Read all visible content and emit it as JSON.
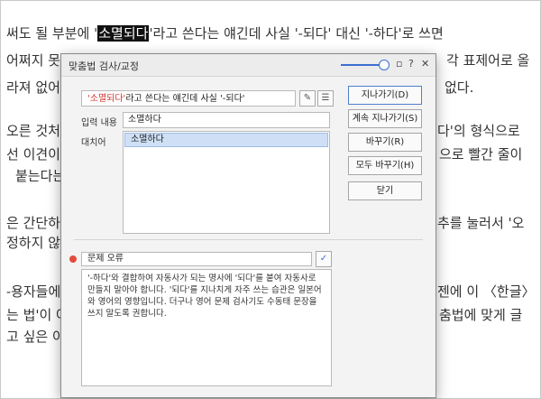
{
  "document": {
    "lines": [
      {
        "before": "써도 될 부분에 '",
        "highlight": "소멸되다",
        "after": "'라고 쓴다는 얘긴데 사실 '-되다' 대신 '-하다'로 쓰면"
      },
      {
        "text": "어쩌지 못"
      },
      {
        "text": "각 표제어로 올"
      },
      {
        "text": "라져 없어"
      },
      {
        "text": "없다."
      },
      {
        "text": "오른 것처럼"
      },
      {
        "text": "다'의 형식으로"
      },
      {
        "text": "선 이견이"
      },
      {
        "text": "으로 빨간 줄이"
      },
      {
        "text": "붙는다는"
      },
      {
        "text": "은 간단하"
      },
      {
        "text": "추를 눌러서 '오"
      },
      {
        "text": "정하지 않고"
      },
      {
        "text": "-용자들에게"
      },
      {
        "text": "젠에 이 〈한글〉"
      },
      {
        "text": "는 법'이 어"
      },
      {
        "text": "춤법에 맞게 글"
      },
      {
        "text": "고 싶은 이"
      }
    ]
  },
  "dialog": {
    "title": "맞춤법 검사/교정",
    "error_phrase": "'소멸되다'",
    "error_rest": "라고 쓴다는 얘긴데 사실 '-되다'",
    "input_label": "입력 내용",
    "input_value": "소멸하다",
    "suggest_label": "대치어",
    "suggestions": [
      "소멸하다"
    ],
    "buttons": {
      "skip": "지나가기(D)",
      "skip_all": "계속 지나가기(S)",
      "replace": "바꾸기(R)",
      "replace_all": "모두 바꾸기(H)",
      "close": "닫기"
    },
    "category": "문제 오류",
    "description": "'-하다'와 결합하여 자동사가 되는 명사에 '되다'를 붙여 자동사로 만들지 말아야 합니다. '되다'를 지나치게 자주 쓰는 습관은 일본어와 영어의 영향입니다. 더구나 영어 문제 검사기도 수동태 문장을 쓰지 말도록 권합니다.",
    "colors": {
      "accent": "#3a6fcf",
      "error": "#d0342c",
      "selection": "#cfe0f6"
    }
  }
}
